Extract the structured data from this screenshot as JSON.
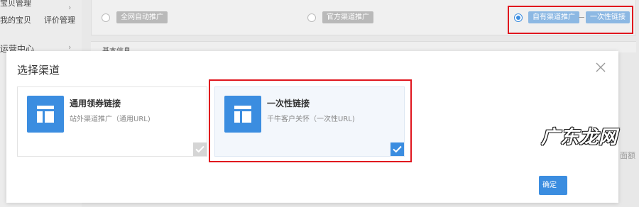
{
  "sidebar": {
    "items": [
      {
        "label": "宝贝管理"
      },
      {
        "label": "我的宝贝"
      },
      {
        "label": "评价管理"
      },
      {
        "label": "运营中心"
      }
    ]
  },
  "channel_options": [
    {
      "label": "全网自动推广",
      "selected": false
    },
    {
      "label": "官方渠道推广",
      "selected": false
    },
    {
      "label": "自有渠道推广",
      "selected": true
    }
  ],
  "selected_sub_tag": "一次性链接",
  "basic_info_label": "基本信息",
  "background_limit_text": "面额",
  "modal": {
    "title": "选择渠道",
    "cards": [
      {
        "title": "通用领券链接",
        "description": "站外渠道推广（通用URL)",
        "checked": false
      },
      {
        "title": "一次性链接",
        "description": "千牛客户关怀（一次性URL)",
        "checked": true
      }
    ],
    "confirm_label": "确定"
  },
  "watermark": "广东龙网",
  "colors": {
    "accent": "#3b8de0",
    "highlight": "#e0161e",
    "tag_gray": "#b9b9b9"
  }
}
